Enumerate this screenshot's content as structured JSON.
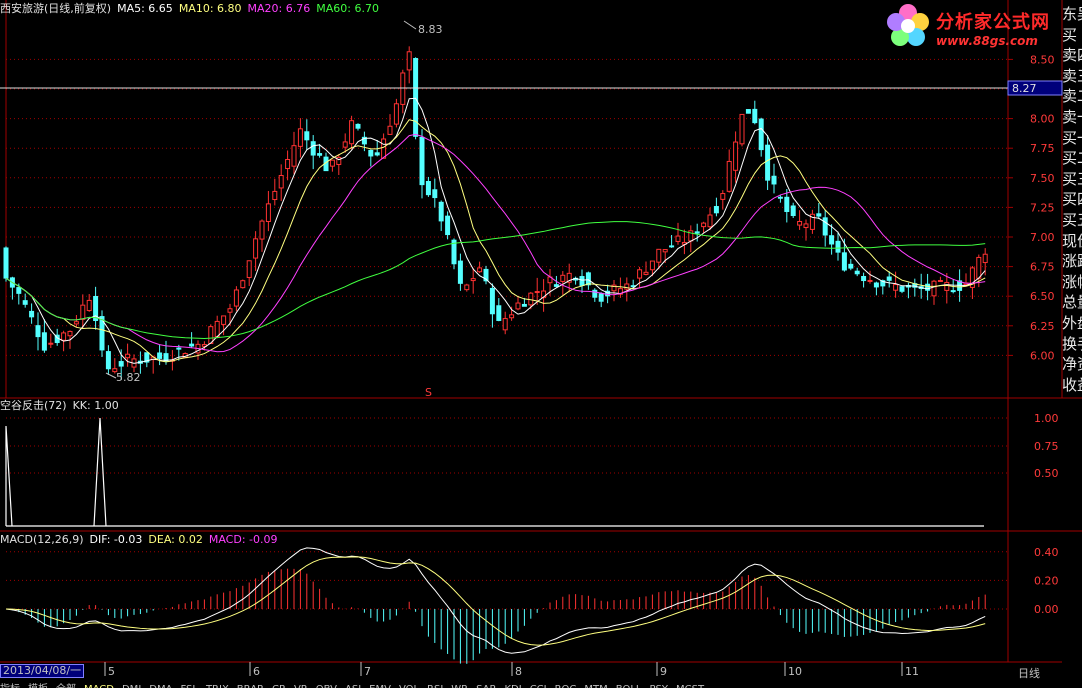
{
  "main": {
    "stock": "西安旅游(日线,前复权)",
    "ma5": "MA5: 6.65",
    "ma10": "MA10: 6.80",
    "ma20": "MA20: 6.76",
    "ma60": "MA60: 6.70",
    "high_label": "8.83",
    "low_label": "5.82",
    "cursor_price": "8.27",
    "s_marker": "S",
    "y_ticks": [
      "8.50",
      "8.25",
      "8.00",
      "7.75",
      "7.50",
      "7.25",
      "7.00",
      "6.75",
      "6.50",
      "6.25",
      "6.00"
    ]
  },
  "indicator": {
    "title": "空谷反击(72)",
    "kk": "KK: 1.00",
    "y_ticks": [
      "1.00",
      "0.75",
      "0.50"
    ]
  },
  "macd": {
    "title": "MACD(12,26,9)",
    "dif": "DIF: -0.03",
    "dea": "DEA: 0.02",
    "macd": "MACD: -0.09",
    "y_ticks": [
      "0.40",
      "0.20",
      "0.00"
    ]
  },
  "right_panel": [
    "东吴",
    "买",
    "卖四",
    "卖三",
    "卖二",
    "卖一",
    "买一",
    "买二",
    "买三",
    "买四",
    "买五",
    "现价",
    "涨跌",
    "涨幅",
    "总量",
    "外盘",
    "换手",
    "净资",
    "收益"
  ],
  "logo": {
    "title": "分析家公式网",
    "url": "www.88gs.com"
  },
  "date_axis": {
    "cursor": "2013/04/08/一",
    "months": [
      "5",
      "6",
      "7",
      "8",
      "9",
      "10",
      "11"
    ],
    "period": "日线"
  },
  "tabs": [
    "指标",
    "模板",
    "全部",
    "MACD",
    "DMI",
    "DMA",
    "FSL",
    "TRIX",
    "BRAR",
    "CR",
    "VR",
    "OBV",
    "ASI",
    "EMV",
    "VOL",
    "RSI",
    "WR",
    "SAR",
    "KDJ",
    "CCI",
    "ROC",
    "MTM",
    "BOLL",
    "PSY",
    "MCST"
  ],
  "colors": {
    "up": "#ff3232",
    "down": "#54ffff",
    "grid": "#a00000",
    "ma5": "#ffffff",
    "ma10": "#ffff80",
    "ma20": "#ff40ff",
    "ma60": "#40ff40"
  }
}
